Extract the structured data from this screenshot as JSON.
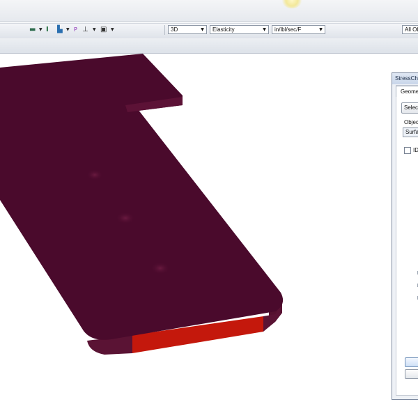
{
  "toolbar": {
    "view_mode": "3D",
    "display_type": "Elasticity",
    "units": "in/lbl/sec/F",
    "filter": "All Ob",
    "icons": [
      "beam-icon",
      "i-beam-icon",
      "member-icon",
      "p-load-icon",
      "support-icon",
      "node-icon"
    ]
  },
  "dialog": {
    "title": "StressChe",
    "tab_label": "Geome",
    "select_button": "Selec",
    "object_label": "Objec",
    "object_type_value": "Surfa",
    "id_checkbox_label": "ID",
    "id_checked": false
  },
  "colors": {
    "model_face": "#4a0a2c",
    "model_edge": "#5c1236",
    "highlight_face": "#c4180c",
    "toolbar_bg": "#e6e9ee"
  }
}
